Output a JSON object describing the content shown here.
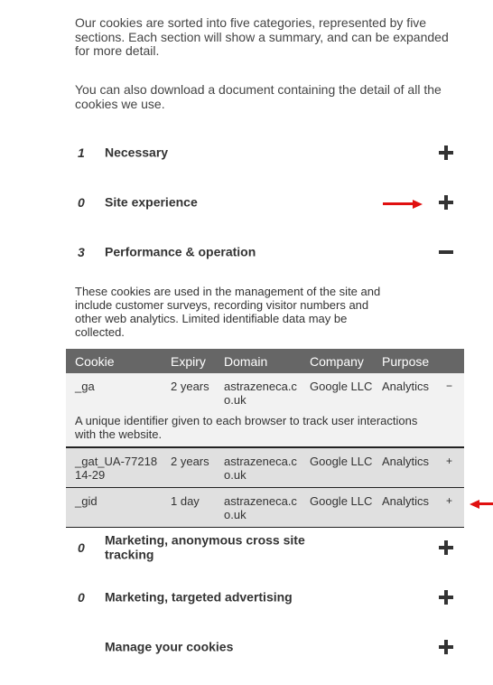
{
  "intro": {
    "paragraph1": "Our cookies are sorted into five categories, represented by five sections. Each section will show a summary, and can be expanded for more detail.",
    "paragraph2": "You can also download a document containing the detail of all the cookies we use."
  },
  "sections": [
    {
      "count": "1",
      "label": "Necessary",
      "state": "collapsed",
      "icon": "plus-icon"
    },
    {
      "count": "0",
      "label": "Site experience",
      "state": "collapsed",
      "icon": "plus-icon"
    },
    {
      "count": "3",
      "label": "Performance & operation",
      "state": "expanded",
      "icon": "minus-icon"
    },
    {
      "count": "0",
      "label": "Marketing, anonymous cross site tracking",
      "state": "collapsed",
      "icon": "plus-icon"
    },
    {
      "count": "0",
      "label": "Marketing, targeted advertising",
      "state": "collapsed",
      "icon": "plus-icon"
    },
    {
      "count": "",
      "label": "Manage your cookies",
      "state": "collapsed",
      "icon": "plus-icon"
    }
  ],
  "performance": {
    "description": "These cookies are used in the management of the site and include customer surveys, recording visitor numbers and other web analytics. Limited identifiable data may be collected.",
    "table": {
      "headers": [
        "Cookie",
        "Expiry",
        "Domain",
        "Company",
        "Purpose"
      ],
      "rows": [
        {
          "cookie": "_ga",
          "expiry": "2 years",
          "domain": "astrazeneca.co.uk",
          "company": "Google LLC",
          "purpose": "Analytics",
          "toggle": "−",
          "expanded": true,
          "detail": "A unique identifier given to each browser to track user interactions with the website."
        },
        {
          "cookie": "_gat_UA-7721814-29",
          "expiry": "2 years",
          "domain": "astrazeneca.co.uk",
          "company": "Google LLC",
          "purpose": "Analytics",
          "toggle": "+",
          "expanded": false
        },
        {
          "cookie": "_gid",
          "expiry": "1 day",
          "domain": "astrazeneca.co.uk",
          "company": "Google LLC",
          "purpose": "Analytics",
          "toggle": "+",
          "expanded": false
        }
      ]
    }
  },
  "annotations": {
    "arrow_color": "#e01010"
  },
  "colors": {
    "table_header_bg": "#666666",
    "row_bg": "#e0e0e0",
    "expanded_row_bg": "#f2f2f2",
    "text": "#333333"
  }
}
